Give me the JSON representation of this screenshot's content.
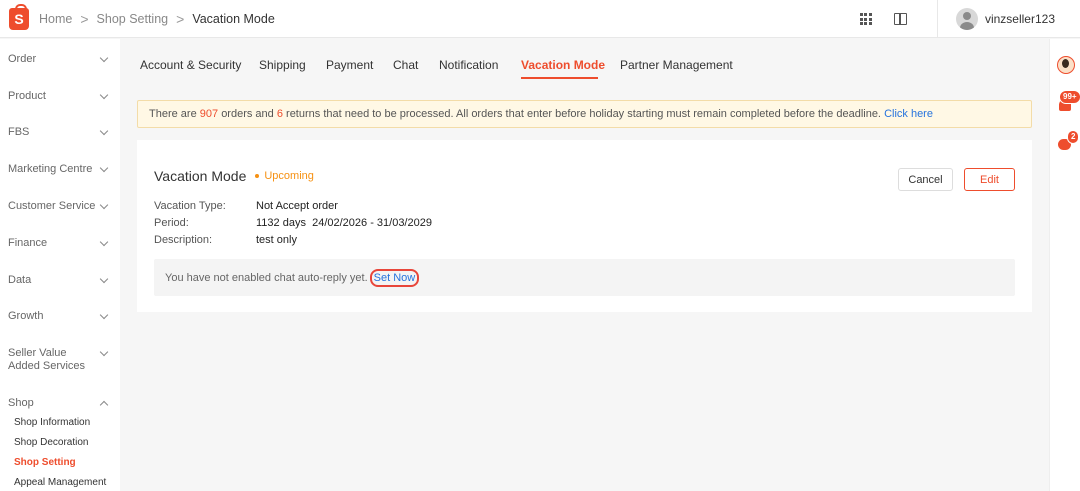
{
  "header": {
    "logo_letter": "S",
    "breadcrumb": [
      "Home",
      "Shop Setting",
      "Vacation Mode"
    ],
    "separator": ">",
    "username": "vinzseller123"
  },
  "sidebar": {
    "items": [
      {
        "label": "Order"
      },
      {
        "label": "Product"
      },
      {
        "label": "FBS"
      },
      {
        "label": "Marketing Centre"
      },
      {
        "label": "Customer Service"
      },
      {
        "label": "Finance"
      },
      {
        "label": "Data"
      },
      {
        "label": "Growth"
      },
      {
        "label": "Seller Value Added Services"
      },
      {
        "label": "Shop"
      }
    ],
    "shop_subitems": [
      "Shop Information",
      "Shop Decoration",
      "Shop Setting",
      "Appeal Management"
    ]
  },
  "rail": {
    "notif_badge": "99+",
    "chat_badge": "2"
  },
  "tabs": [
    "Account & Security",
    "Shipping",
    "Payment",
    "Chat",
    "Notification",
    "Vacation Mode",
    "Partner Management"
  ],
  "notice": {
    "p1": "There are",
    "orders_count": "907",
    "p2": "orders and",
    "returns_count": "6",
    "p3": "returns that need to be processed. All orders that enter before holiday starting must remain completed before the deadline.",
    "link": "Click here"
  },
  "card": {
    "title": "Vacation Mode",
    "status": "Upcoming",
    "cancel_label": "Cancel",
    "edit_label": "Edit",
    "type_label": "Vacation Type:",
    "type_value": "Not Accept order",
    "period_label": "Period:",
    "period_days": "1132 days",
    "period_range": "24/02/2026 - 31/03/2029",
    "desc_label": "Description:",
    "desc_value": "test only",
    "reply_text": "You have not enabled chat auto-reply yet.",
    "reply_link": "Set Now"
  },
  "colors": {
    "brand": "#ee4d2d",
    "link": "#2673dd",
    "upcoming": "#f69113"
  }
}
